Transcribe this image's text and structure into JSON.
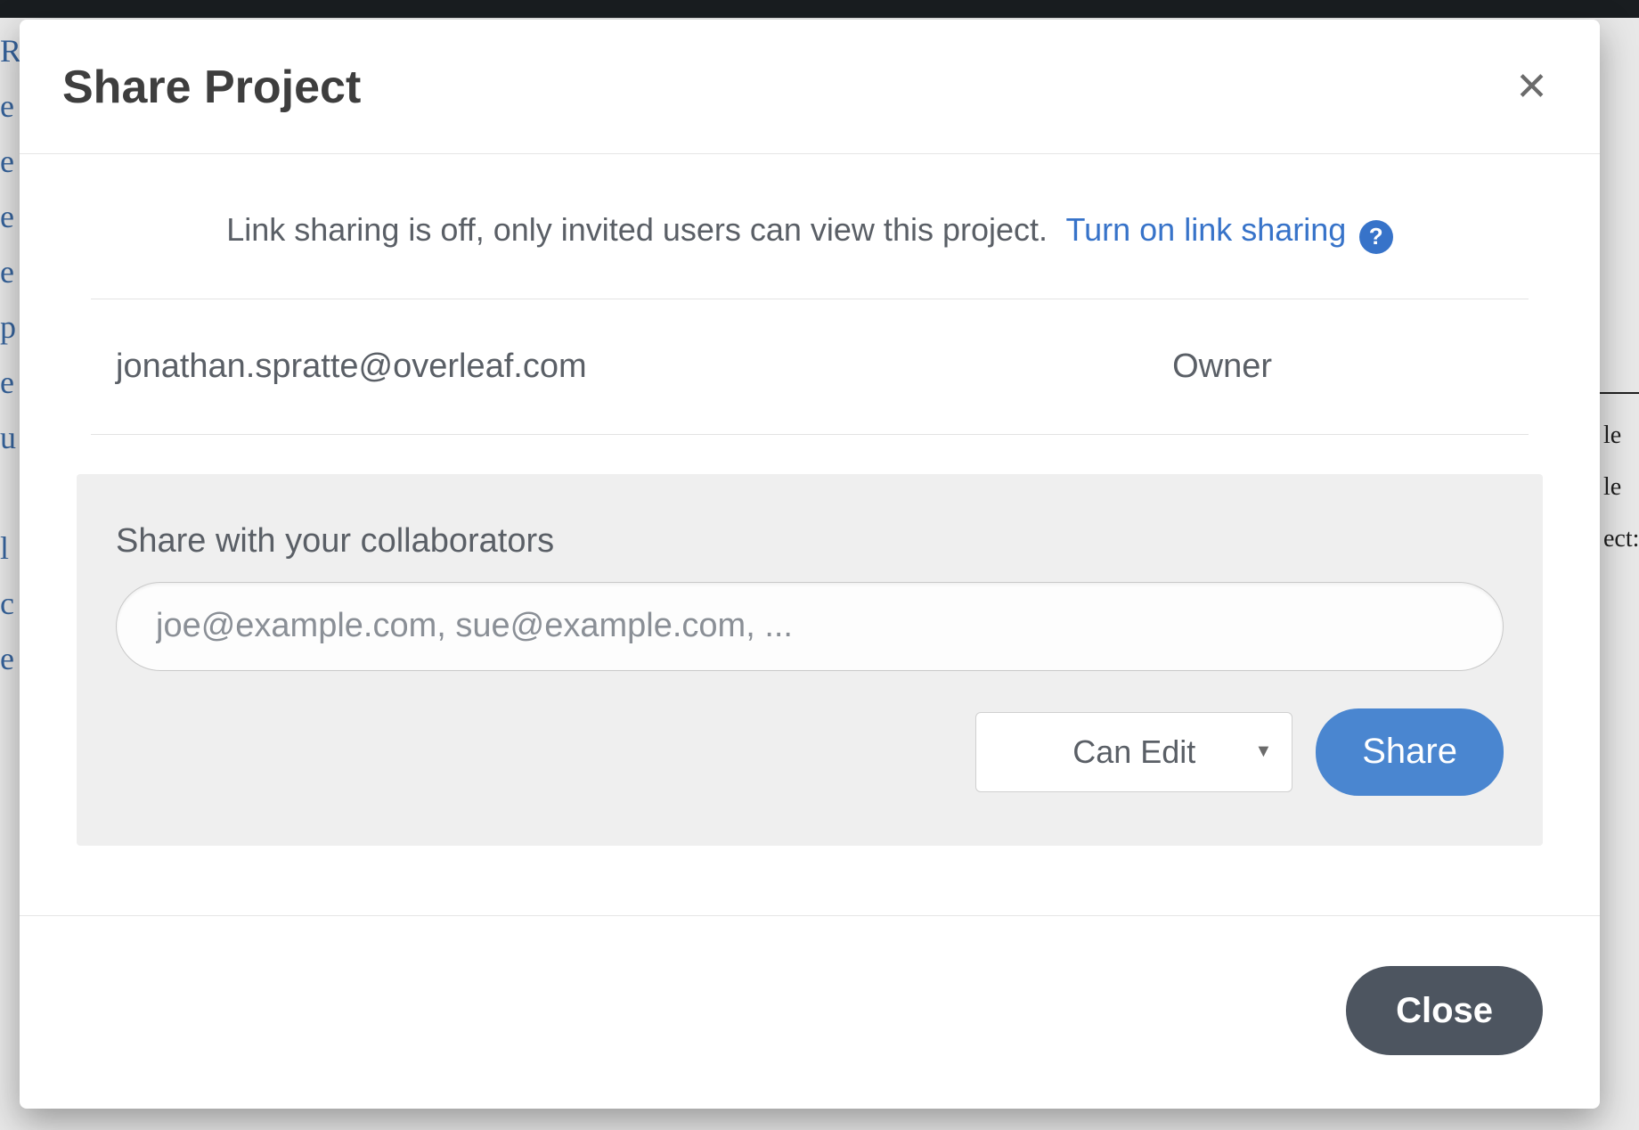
{
  "background": {
    "left_glyphs": "R\ne\ne\ne\ne\np\ne\nu\n\nl\nc\ne",
    "right_glyphs": "le\nle\nect:"
  },
  "modal": {
    "title": "Share Project",
    "close_x": "✕",
    "link_sharing": {
      "message": "Link sharing is off, only invited users can view this project.",
      "action": "Turn on link sharing",
      "help_glyph": "?"
    },
    "members": [
      {
        "email": "jonathan.spratte@overleaf.com",
        "role": "Owner"
      }
    ],
    "share_panel": {
      "label": "Share with your collaborators",
      "placeholder": "joe@example.com, sue@example.com, ...",
      "permission_selected": "Can Edit",
      "permission_caret": "▼",
      "share_button": "Share"
    },
    "footer": {
      "close_button": "Close"
    }
  }
}
